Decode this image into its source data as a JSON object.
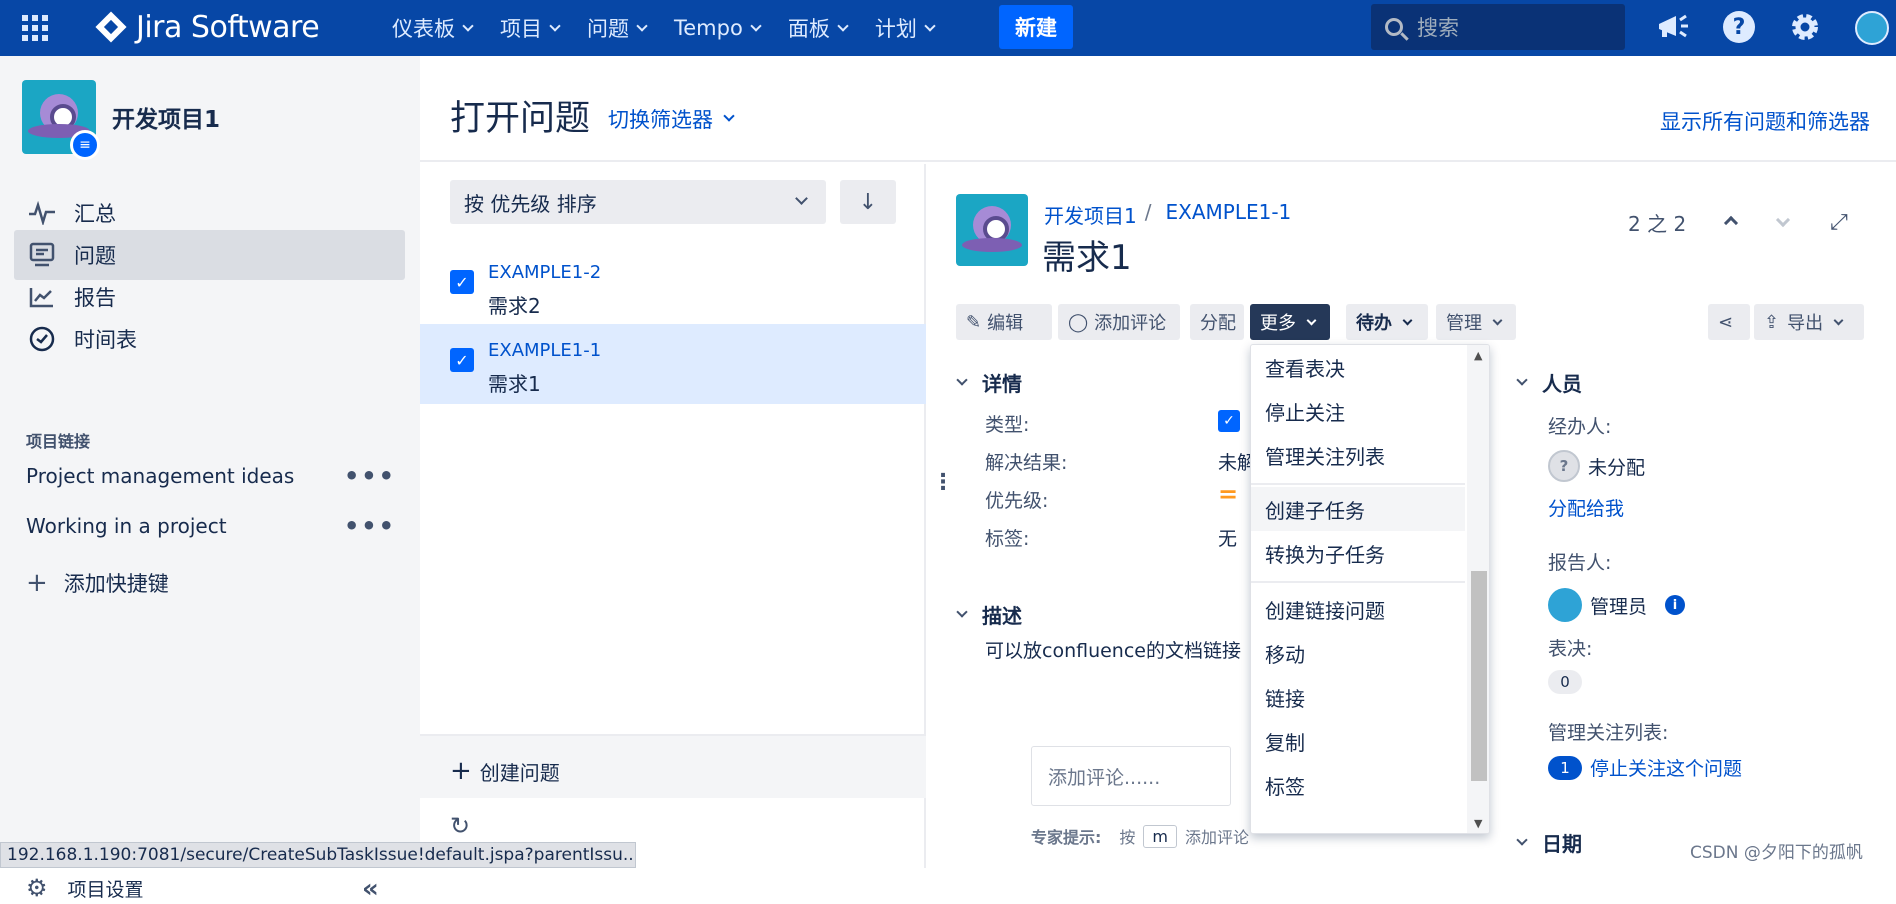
{
  "topnav": {
    "logo_text": "Jira Software",
    "menu": [
      "仪表板",
      "项目",
      "问题",
      "Tempo",
      "面板",
      "计划"
    ],
    "create_label": "新建",
    "search_placeholder": "搜索",
    "help_label": "?",
    "colors": {
      "bg": "#0747a6",
      "create": "#0065ff"
    }
  },
  "sidebar": {
    "project_name": "开发项目1",
    "nav": [
      {
        "label": "汇总",
        "icon": "activity-icon"
      },
      {
        "label": "问题",
        "icon": "issues-icon",
        "active": true
      },
      {
        "label": "报告",
        "icon": "chart-icon"
      },
      {
        "label": "时间表",
        "icon": "clock-icon"
      }
    ],
    "section_title": "项目链接",
    "links": [
      "Project management ideas",
      "Working in a project"
    ],
    "add_shortcut": "添加快捷键",
    "settings": "项目设置"
  },
  "status_url": "192.168.1.190:7081/secure/CreateSubTaskIssue!default.jspa?parentIssu...",
  "header": {
    "title": "打开问题",
    "switch_filter": "切换筛选器",
    "show_all": "显示所有问题和筛选器"
  },
  "list": {
    "sort_label": "按 优先级 排序",
    "sort_dir": "↓",
    "issues": [
      {
        "key": "EXAMPLE1-2",
        "summary": "需求2"
      },
      {
        "key": "EXAMPLE1-1",
        "summary": "需求1"
      }
    ],
    "create_issue": "创建问题"
  },
  "detail": {
    "breadcrumb_project": "开发项目1",
    "breadcrumb_sep": "/",
    "breadcrumb_key": "EXAMPLE1-1",
    "title": "需求1",
    "pager": "2 之 2",
    "toolbar": {
      "edit": "编辑",
      "comment": "添加评论",
      "assign": "分配",
      "more": "更多",
      "status": "待办",
      "admin": "管理",
      "export": "导出"
    },
    "details_heading": "详情",
    "fields": [
      {
        "label": "类型:",
        "value": ""
      },
      {
        "label": "解决结果:",
        "value": "未解"
      },
      {
        "label": "优先级:",
        "value": "="
      },
      {
        "label": "标签:",
        "value": "无"
      }
    ],
    "description_heading": "描述",
    "description": "可以放confluence的文档链接",
    "comment_placeholder": "添加评论......",
    "protip_label": "专家提示:",
    "protip_press": "按",
    "protip_key": "m",
    "protip_action": "添加评论"
  },
  "people": {
    "heading": "人员",
    "assignee_label": "经办人:",
    "assignee": "未分配",
    "assign_me": "分配给我",
    "reporter_label": "报告人:",
    "reporter": "管理员",
    "votes_label": "表决:",
    "votes": "0",
    "watchers_label": "管理关注列表:",
    "watchers_count": "1",
    "stop_watch": "停止关注这个问题",
    "dates_heading": "日期"
  },
  "more_menu": {
    "items": [
      "查看表决",
      "停止关注",
      "管理关注列表",
      "创建子任务",
      "转换为子任务",
      "创建链接问题",
      "移动",
      "链接",
      "复制",
      "标签"
    ]
  },
  "watermark": "CSDN @夕阳下的孤帆"
}
